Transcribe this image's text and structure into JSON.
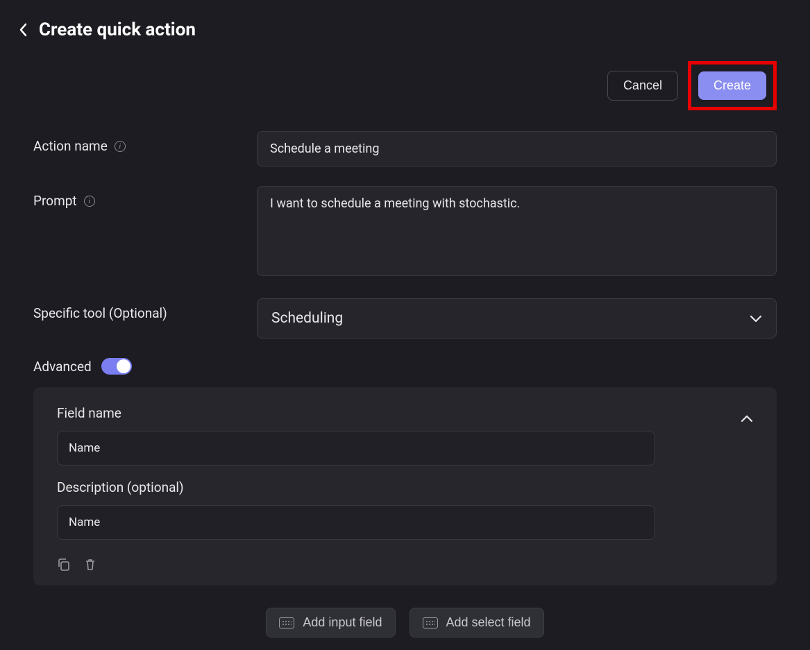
{
  "header": {
    "title": "Create quick action"
  },
  "actions": {
    "cancel_label": "Cancel",
    "create_label": "Create"
  },
  "form": {
    "action_name": {
      "label": "Action name",
      "value": "Schedule a meeting"
    },
    "prompt": {
      "label": "Prompt",
      "value": "I want to schedule a meeting with stochastic."
    },
    "specific_tool": {
      "label": "Specific tool (Optional)",
      "value": "Scheduling"
    },
    "advanced": {
      "label": "Advanced",
      "enabled": true,
      "card": {
        "field_name_label": "Field name",
        "field_name_value": "Name",
        "description_label": "Description (optional)",
        "description_value": "Name"
      }
    },
    "add_input_label": "Add input field",
    "add_select_label": "Add select field"
  }
}
